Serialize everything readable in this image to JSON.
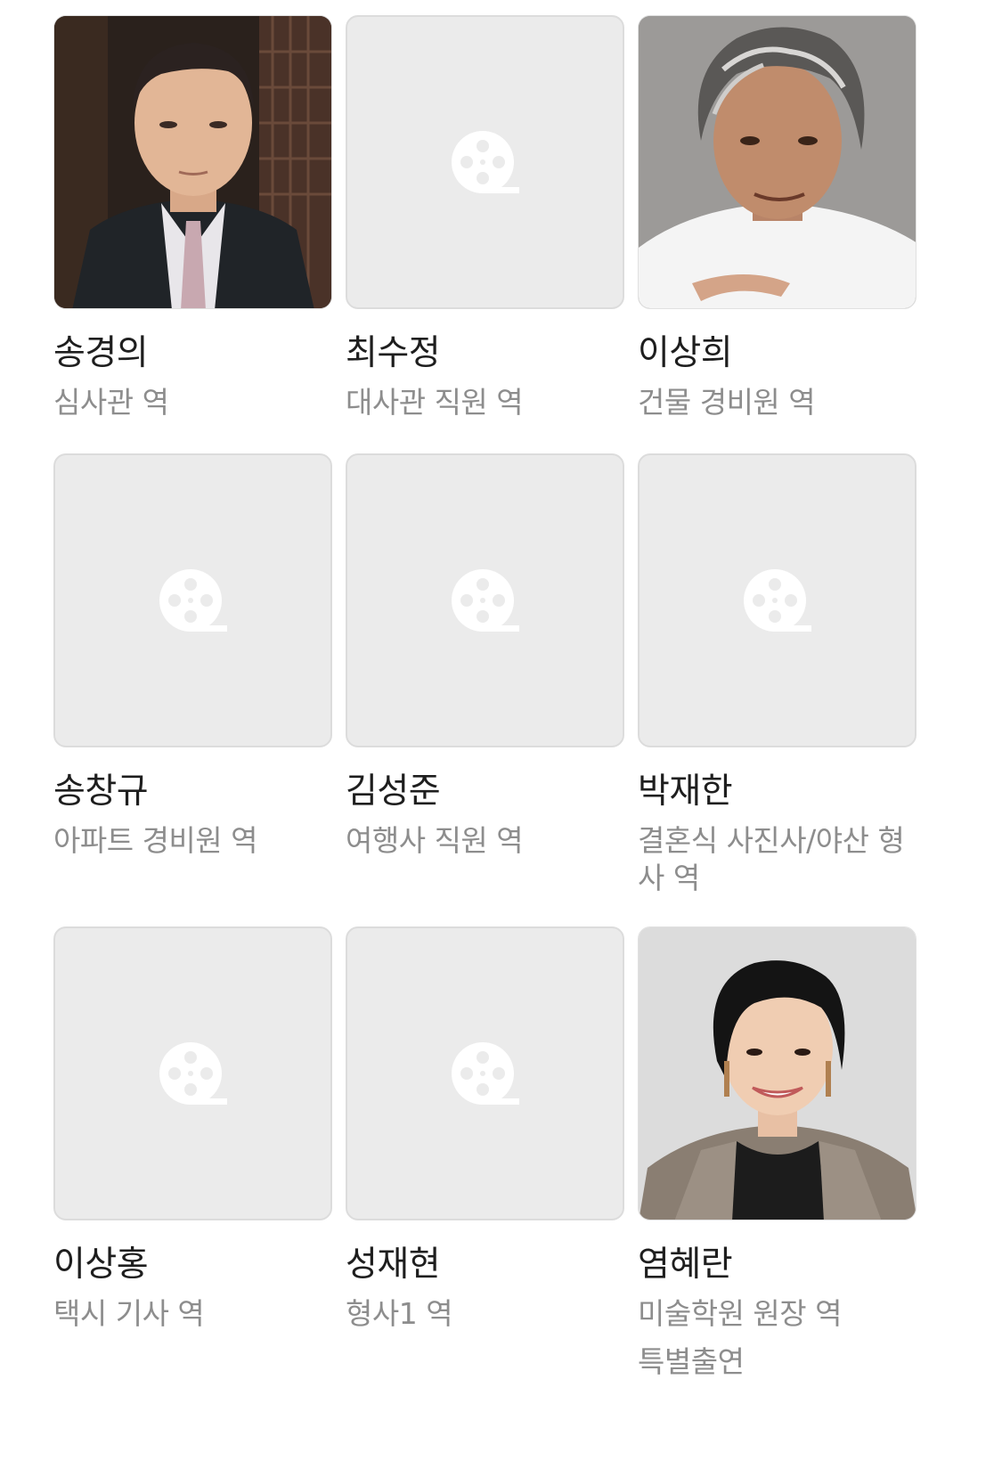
{
  "cast": [
    {
      "name": "송경의",
      "role": "심사관 역",
      "photo": "man-suit-portrait"
    },
    {
      "name": "최수정",
      "role": "대사관 직원 역",
      "photo": "film-reel-placeholder"
    },
    {
      "name": "이상희",
      "role": "건물 경비원 역",
      "photo": "man-gray-hair-portrait"
    },
    {
      "name": "송창규",
      "role": "아파트 경비원 역",
      "photo": "film-reel-placeholder"
    },
    {
      "name": "김성준",
      "role": "여행사 직원 역",
      "photo": "film-reel-placeholder"
    },
    {
      "name": "박재한",
      "role": "결혼식 사진사/야산 형사 역",
      "photo": "film-reel-placeholder"
    },
    {
      "name": "이상홍",
      "role": "택시 기사 역",
      "photo": "film-reel-placeholder"
    },
    {
      "name": "성재현",
      "role": "형사1 역",
      "photo": "film-reel-placeholder"
    },
    {
      "name": "염혜란",
      "role": "미술학원 원장 역",
      "extra": "특별출연",
      "photo": "woman-short-hair-portrait"
    }
  ],
  "colors": {
    "name": "#1e1e1e",
    "role": "#8d8d8d",
    "placeholder_bg": "#ebebeb",
    "placeholder_border": "#dcdcdc"
  }
}
